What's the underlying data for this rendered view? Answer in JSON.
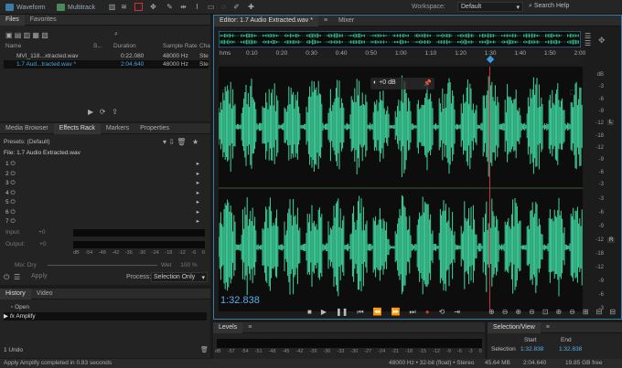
{
  "topbar": {
    "waveform": "Waveform",
    "multitrack": "Multitrack",
    "workspace_label": "Workspace:",
    "workspace_value": "Default",
    "search": "Search Help"
  },
  "files": {
    "tab": "Files",
    "tab2": "Favorites",
    "cols": {
      "name": "Name",
      "s": "S...",
      "duration": "Duration",
      "rate": "Sample Rate",
      "ch": "Cha"
    },
    "rows": [
      {
        "name": "MVI_118...xtracted.wav",
        "duration": "0:22.080",
        "rate": "48000 Hz",
        "ch": "Ste"
      },
      {
        "name": "1.7 Aud...tracted.wav *",
        "duration": "2:04.640",
        "rate": "48000 Hz",
        "ch": "Ste"
      }
    ]
  },
  "effects": {
    "tabs": [
      "Media Browser",
      "Effects Rack",
      "Markers",
      "Properties"
    ],
    "presets_label": "Presets:",
    "presets_value": "(Default)",
    "file": "File: 1.7 Audio Extracted.wav",
    "slots": [
      "1",
      "2",
      "3",
      "4",
      "5",
      "6",
      "7"
    ],
    "input": "Input:",
    "output": "Output:",
    "zero": "+0",
    "scale": [
      "dB",
      "-54",
      "-48",
      "-42",
      "-36",
      "-30",
      "-24",
      "-18",
      "-12",
      "-6",
      "0"
    ],
    "mix": "Mix:",
    "dry": "Dry",
    "wet": "Wet",
    "wet_pct": "100 %",
    "apply": "Apply",
    "process_label": "Process:",
    "process_value": "Selection Only"
  },
  "history": {
    "tabs": [
      "History",
      "Video"
    ],
    "items": [
      "Open",
      "Amplify"
    ],
    "undo": "1 Undo"
  },
  "editor": {
    "tab": "Editor: 1.7 Audio Extracted.wav *",
    "mixer": "Mixer",
    "ruler_unit": "hms",
    "ticks": [
      "0:10",
      "0:20",
      "0:30",
      "0:40",
      "0:50",
      "1:00",
      "1:10",
      "1:20",
      "1:30",
      "1:40",
      "1:50",
      "2:00"
    ],
    "db_top": [
      "dB",
      "-3",
      "-6",
      "-9",
      "-12",
      "-18",
      "-12",
      "-9",
      "-6",
      "-3"
    ],
    "db_bottom": [
      "-3",
      "-6",
      "-9",
      "-12",
      "-18",
      "-12",
      "-9",
      "-6",
      "-3"
    ],
    "hud": "+0 dB",
    "time": "1:32.838",
    "ch_left": "L",
    "ch_right": "R"
  },
  "levels": {
    "tab": "Levels",
    "scale": [
      "dB",
      "-57",
      "-54",
      "-51",
      "-48",
      "-45",
      "-42",
      "-39",
      "-36",
      "-33",
      "-30",
      "-27",
      "-24",
      "-21",
      "-18",
      "-15",
      "-12",
      "-9",
      "-6",
      "-3",
      "0"
    ]
  },
  "selection": {
    "tab": "Selection/View",
    "start": "Start",
    "end": "End",
    "label": "Selection",
    "start_val": "1:32.838",
    "end_val": "1:32.838"
  },
  "status": {
    "left": "Apply Amplify completed in 0.83 seconds",
    "format": "48000 Hz • 32-bit (float) • Stereo",
    "size": "45.64 MB",
    "dur": "2:04.640",
    "free": "19.85 GB free"
  },
  "colors": {
    "wave": "#3fd6a0",
    "playhead": "#d0303a",
    "accent": "#3a9ad9"
  }
}
